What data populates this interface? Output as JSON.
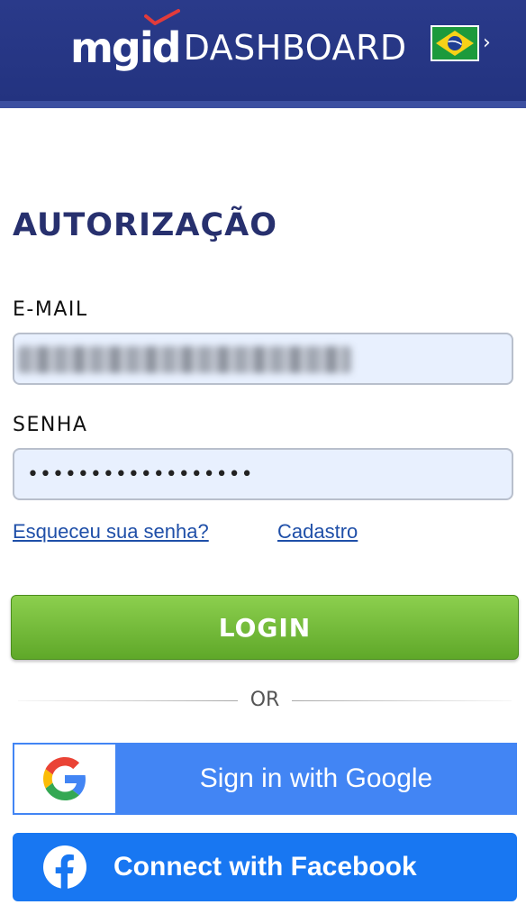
{
  "header": {
    "logo_brand": "mgid",
    "logo_product": "DASHBOARD",
    "language_flag": "brazil-flag-icon",
    "language_chevron": "›"
  },
  "form": {
    "title": "AUTORIZAÇÃO",
    "email_label": "E-MAIL",
    "email_value": "",
    "password_label": "SENHA",
    "password_value": "••••••••••••••••••",
    "forgot_link": "Esqueceu sua senha?",
    "signup_link": "Cadastro",
    "login_button": "LOGIN"
  },
  "divider": {
    "text": "OR"
  },
  "social": {
    "google_label": "Sign in with Google",
    "google_icon": "google-icon",
    "facebook_label": "Connect with Facebook",
    "facebook_icon": "facebook-icon"
  },
  "colors": {
    "header_bg": "#233380",
    "title": "#27306e",
    "link": "#1f4fa8",
    "login_green": "#6ab534",
    "google_blue": "#4285f4",
    "facebook_blue": "#1877f2"
  }
}
